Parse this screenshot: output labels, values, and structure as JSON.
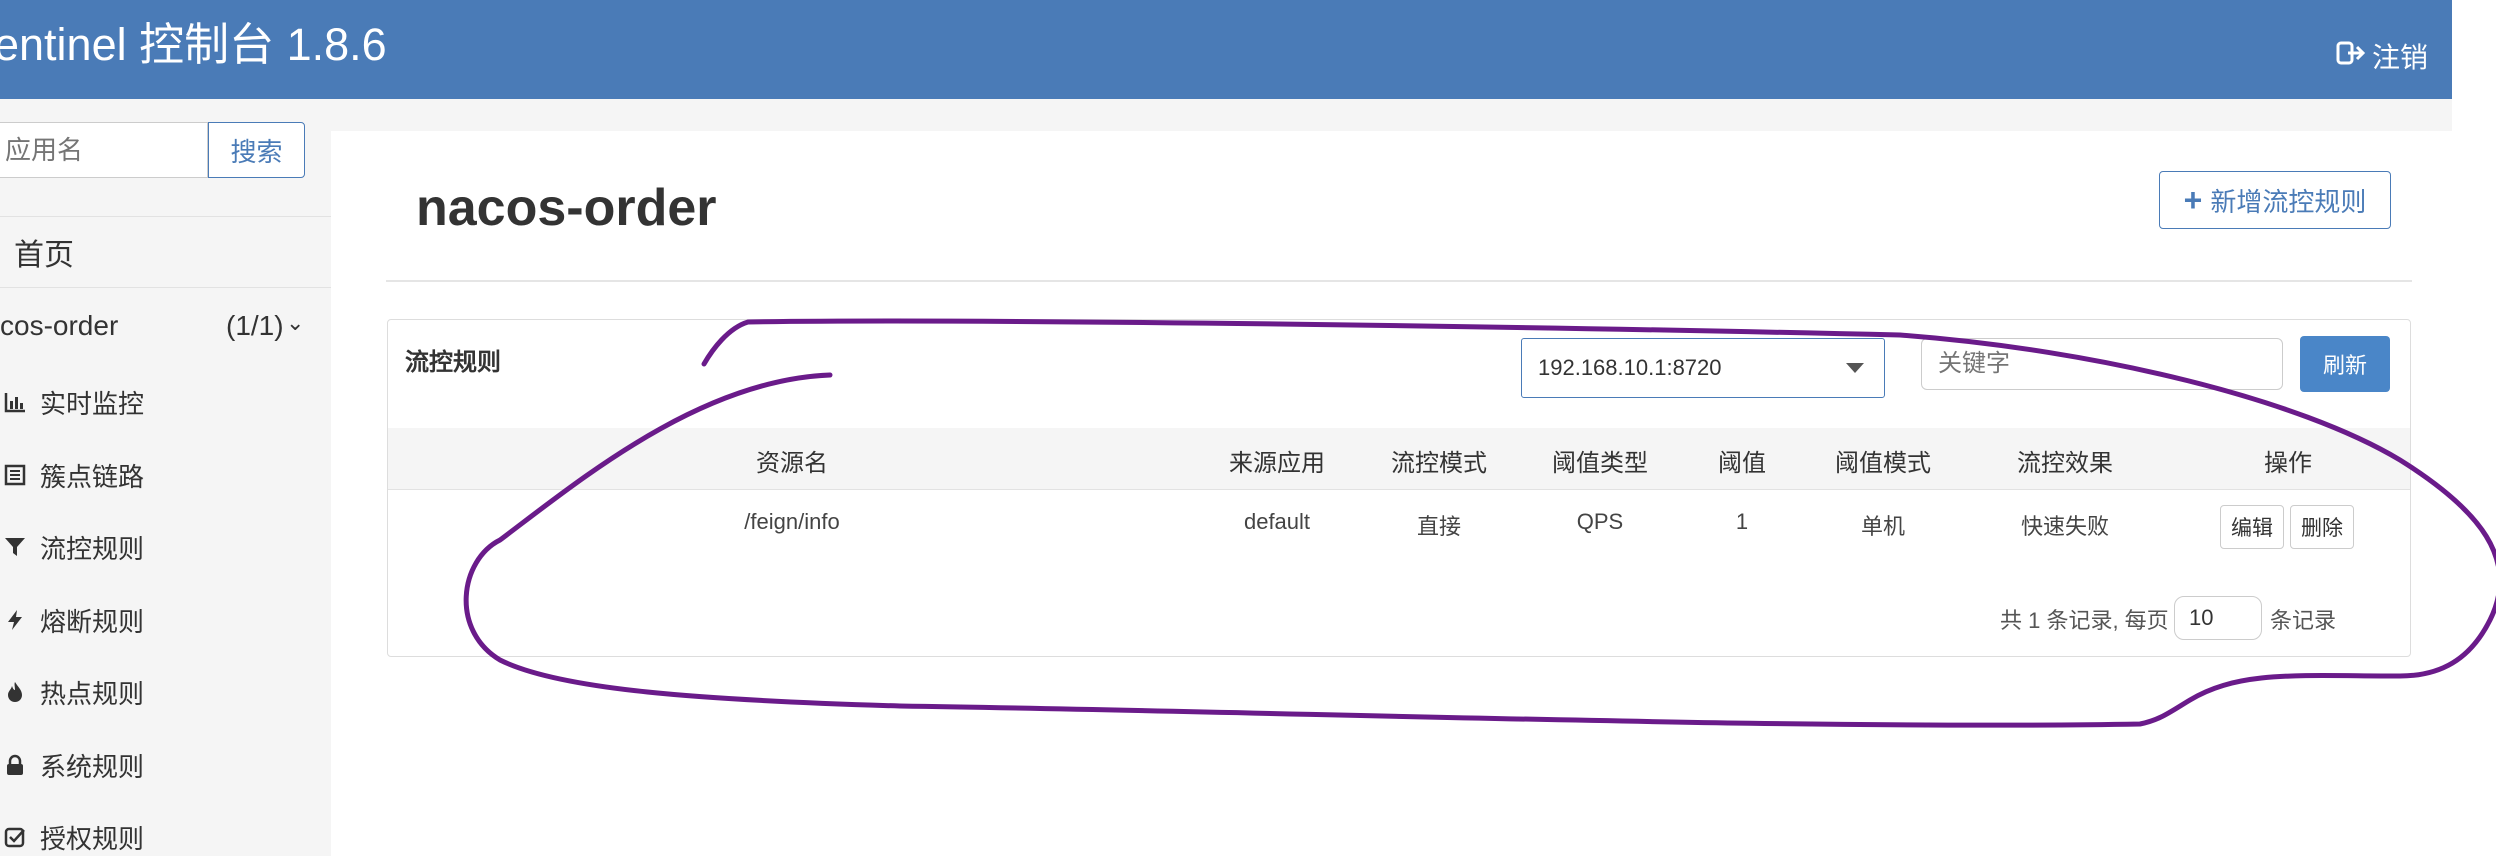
{
  "header": {
    "brand": "entinel 控制台 1.8.6",
    "logout_label": "注销",
    "colors": {
      "bar": "#4a7bb7",
      "text": "#ffffff"
    }
  },
  "sidebar": {
    "search_placeholder": "应用名",
    "search_button": "搜索",
    "home_label": "首页",
    "app": {
      "name": "cos-order",
      "count": "(1/1)"
    },
    "items": [
      {
        "label": "实时监控",
        "icon": "bar-chart-icon"
      },
      {
        "label": "簇点链路",
        "icon": "list-icon"
      },
      {
        "label": "流控规则",
        "icon": "filter-icon"
      },
      {
        "label": "熔断规则",
        "icon": "bolt-icon"
      },
      {
        "label": "热点规则",
        "icon": "fire-icon"
      },
      {
        "label": "系统规则",
        "icon": "lock-icon"
      },
      {
        "label": "授权规则",
        "icon": "check-square-icon"
      }
    ]
  },
  "main": {
    "title": "nacos-order",
    "add_button": "新增流控规则",
    "panel_title": "流控规则",
    "machine": "192.168.10.1:8720",
    "keyword_placeholder": "关键字",
    "refresh_button": "刷新",
    "columns": [
      "资源名",
      "来源应用",
      "流控模式",
      "阈值类型",
      "阈值",
      "阈值模式",
      "流控效果",
      "操作"
    ],
    "rows": [
      {
        "resource": "/feign/info",
        "origin": "default",
        "mode": "直接",
        "threshold_type": "QPS",
        "threshold": "1",
        "cluster_mode": "单机",
        "effect": "快速失败",
        "edit": "编辑",
        "delete": "删除"
      }
    ],
    "pager": {
      "summary": "共 1 条记录, 每页",
      "page_size": "10",
      "suffix": "条记录"
    }
  },
  "annotation": {
    "color": "#6a1b8a"
  }
}
